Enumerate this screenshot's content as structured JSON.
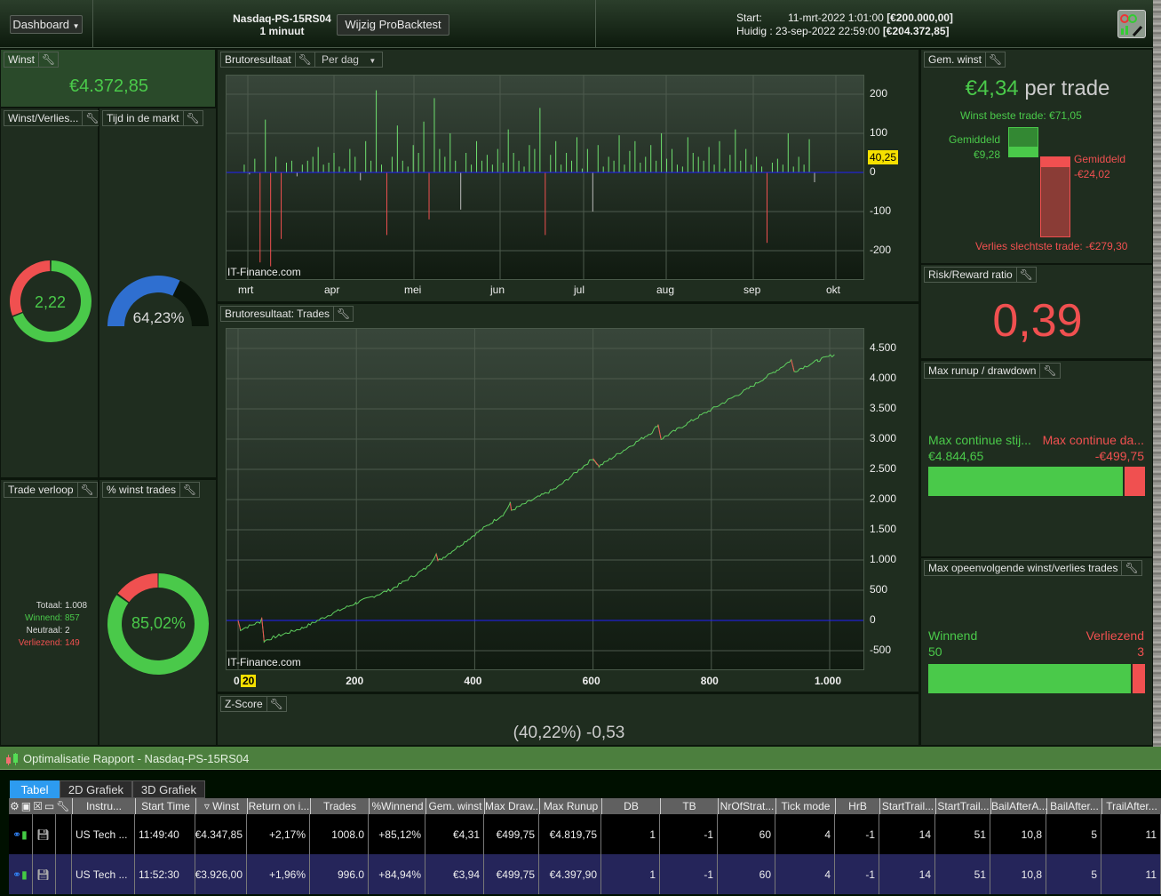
{
  "header": {
    "dashboard_label": "Dashboard",
    "strategy_name": "Nasdaq-PS-15RS04",
    "timeframe": "1 minuut",
    "edit_button": "Wijzig ProBacktest",
    "start_label": "Start:",
    "start_date": "11-mrt-2022 1:01:00",
    "start_capital": "[€200.000,00]",
    "current_label": "Huidig :",
    "current_date": "23-sep-2022 22:59:00",
    "current_capital": "[€204.372,85]"
  },
  "winst": {
    "title": "Winst",
    "value": "€4.372,85"
  },
  "winst_verlies": {
    "title": "Winst/Verlies...",
    "value": "2,22",
    "loss_fraction": 0.31
  },
  "tijd_markt": {
    "title": "Tijd in de markt",
    "value": "64,23%",
    "fraction": 0.6423
  },
  "trade_verloop": {
    "title": "Trade verloop",
    "rows": [
      {
        "label": "Totaal:",
        "value": "1.008"
      },
      {
        "label": "Winnend:",
        "value": "857"
      },
      {
        "label": "Neutraal:",
        "value": "2"
      },
      {
        "label": "Verliezend:",
        "value": "149"
      }
    ]
  },
  "pct_winst": {
    "title": "% winst trades",
    "value": "85,02%",
    "fraction": 0.8502
  },
  "brutoresultaat": {
    "title": "Brutoresultaat",
    "mode": "Per dag",
    "watermark": "IT-Finance.com",
    "current_label": "40,25",
    "y_ticks": [
      "200",
      "100",
      "0",
      "-100",
      "-200"
    ],
    "x_ticks": [
      "mrt",
      "apr",
      "mei",
      "jun",
      "jul",
      "aug",
      "sep",
      "okt"
    ],
    "daily_values": [
      0,
      20,
      -5,
      35,
      -230,
      135,
      -240,
      40,
      -170,
      25,
      30,
      -10,
      20,
      30,
      40,
      65,
      20,
      25,
      50,
      15,
      10,
      60,
      40,
      -20,
      80,
      30,
      210,
      20,
      -160,
      40,
      120,
      30,
      15,
      70,
      50,
      130,
      -120,
      190,
      60,
      40,
      100,
      30,
      -95,
      50,
      20,
      80,
      30,
      45,
      20,
      60,
      25,
      110,
      50,
      30,
      15,
      70,
      60,
      165,
      -160,
      45,
      80,
      20,
      50,
      30,
      90,
      10,
      60,
      -100,
      70,
      15,
      40,
      30,
      95,
      20,
      55,
      80,
      25,
      40,
      70,
      30,
      100,
      35,
      60,
      20,
      15,
      90,
      50,
      40,
      30,
      65,
      20,
      80,
      10,
      45,
      110,
      30,
      60,
      20,
      40,
      15,
      -180,
      25,
      35,
      20,
      100,
      15,
      40,
      20,
      85,
      -25
    ]
  },
  "trades_chart": {
    "title": "Brutoresultaat: Trades",
    "watermark": "IT-Finance.com",
    "y_ticks": [
      "4.500",
      "4.000",
      "3.500",
      "3.000",
      "2.500",
      "2.000",
      "1.500",
      "1.000",
      "500",
      "0",
      "-500"
    ],
    "x_ticks": [
      "0",
      "200",
      "400",
      "600",
      "800",
      "1.000"
    ],
    "x_marker": "20",
    "equity": [
      [
        0,
        0
      ],
      [
        4,
        -150
      ],
      [
        38,
        -20
      ],
      [
        40,
        50
      ],
      [
        44,
        -340
      ],
      [
        60,
        -280
      ],
      [
        110,
        -120
      ],
      [
        160,
        120
      ],
      [
        200,
        290
      ],
      [
        260,
        520
      ],
      [
        320,
        880
      ],
      [
        335,
        1100
      ],
      [
        338,
        980
      ],
      [
        400,
        1420
      ],
      [
        450,
        1770
      ],
      [
        460,
        1940
      ],
      [
        462,
        1820
      ],
      [
        540,
        2200
      ],
      [
        600,
        2680
      ],
      [
        610,
        2550
      ],
      [
        700,
        3120
      ],
      [
        710,
        3240
      ],
      [
        715,
        3000
      ],
      [
        780,
        3380
      ],
      [
        860,
        3820
      ],
      [
        920,
        4200
      ],
      [
        935,
        4310
      ],
      [
        940,
        4120
      ],
      [
        980,
        4300
      ],
      [
        1008,
        4400
      ]
    ]
  },
  "zscore": {
    "title": "Z-Score",
    "value": "(40,22%) -0,53"
  },
  "gem_winst": {
    "title": "Gem. winst",
    "value": "€4,34",
    "suffix": "per trade",
    "best": "Winst beste trade: €71,05",
    "avg_win_label": "Gemiddeld",
    "avg_win": "€9,28",
    "avg_loss_label": "Gemiddeld",
    "avg_loss": "-€24,02",
    "worst": "Verlies slechtste trade: -€279,30"
  },
  "risk_reward": {
    "title": "Risk/Reward ratio",
    "value": "0,39"
  },
  "runup": {
    "title": "Max runup / drawdown",
    "up_label": "Max continue stij...",
    "down_label": "Max continue da...",
    "up_value": "€4.844,65",
    "down_value": "-€499,75",
    "up_fraction": 0.906
  },
  "consec": {
    "title": "Max opeenvolgende winst/verlies trades",
    "win_label": "Winnend",
    "loss_label": "Verliezend",
    "win_value": "50",
    "loss_value": "3",
    "win_fraction": 0.943
  },
  "report": {
    "title": "Optimalisatie Rapport - Nasdaq-PS-15RS04",
    "tabs": [
      "Tabel",
      "2D Grafiek",
      "3D Grafiek"
    ],
    "columns": [
      "Instru...",
      "Start Time",
      "Winst",
      "Return on i...",
      "Trades",
      "%Winnend",
      "Gem. winst",
      "Max Draw...",
      "Max Runup",
      "DB",
      "TB",
      "NrOfStrat...",
      "Tick mode",
      "HrB",
      "StartTrail...",
      "StartTrail...",
      "BailAfterA...",
      "BailAfter...",
      "TrailAfter..."
    ],
    "rows": [
      [
        "US Tech ...",
        "11:49:40",
        "€4.347,85",
        "+2,17%",
        "1008.0",
        "+85,12%",
        "€4,31",
        "€499,75",
        "€4.819,75",
        "1",
        "-1",
        "60",
        "4",
        "-1",
        "14",
        "51",
        "10,8",
        "5",
        "11"
      ],
      [
        "US Tech ...",
        "11:52:30",
        "€3.926,00",
        "+1,96%",
        "996.0",
        "+84,94%",
        "€3,94",
        "€499,75",
        "€4.397,90",
        "1",
        "-1",
        "60",
        "4",
        "-1",
        "14",
        "51",
        "10,8",
        "5",
        "11"
      ]
    ]
  },
  "colors": {
    "green": "#4ac94a",
    "red": "#f05050",
    "blue": "#2f6fd0",
    "row_selected": "#25255a"
  }
}
